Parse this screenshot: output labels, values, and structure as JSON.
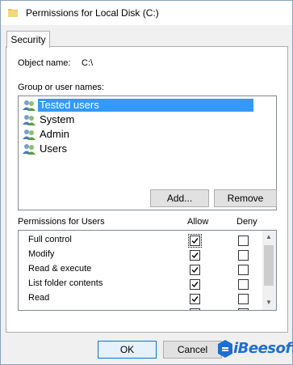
{
  "window": {
    "title": "Permissions for Local Disk (C:)"
  },
  "tabs": [
    {
      "label": "Security"
    }
  ],
  "object": {
    "label": "Object name:",
    "value": "C:\\"
  },
  "groups": {
    "label": "Group or user names:",
    "items": [
      {
        "label": "Tested users",
        "selected": true
      },
      {
        "label": "System",
        "selected": false
      },
      {
        "label": "Admin",
        "selected": false
      },
      {
        "label": "Users",
        "selected": false
      }
    ]
  },
  "buttons": {
    "add": "Add...",
    "remove": "Remove",
    "ok": "OK",
    "cancel": "Cancel"
  },
  "permissions": {
    "label": "Permissions for Users",
    "allow_label": "Allow",
    "deny_label": "Deny",
    "rows": [
      {
        "name": "Full control",
        "allow": true,
        "deny": false
      },
      {
        "name": "Modify",
        "allow": true,
        "deny": false
      },
      {
        "name": "Read & execute",
        "allow": true,
        "deny": false
      },
      {
        "name": "List folder contents",
        "allow": true,
        "deny": false
      },
      {
        "name": "Read",
        "allow": true,
        "deny": false
      },
      {
        "name": "",
        "allow": true,
        "deny": false
      }
    ]
  },
  "watermark": {
    "text": "iBeesoft"
  },
  "colors": {
    "selection": "#3399ff",
    "accent": "#0078d7",
    "watermark": "#1e6fd0"
  }
}
